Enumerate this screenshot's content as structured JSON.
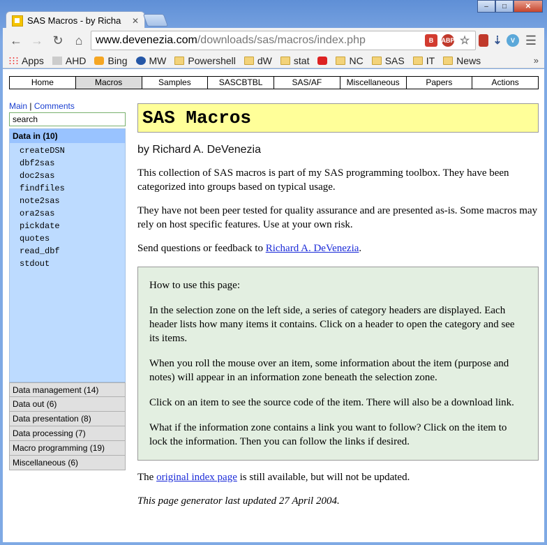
{
  "browser": {
    "tab_title": "SAS Macros - by Richa",
    "url_host": "www.devenezia.com",
    "url_path": "/downloads/sas/macros/index.php",
    "bookmarks": [
      "Apps",
      "AHD",
      "Bing",
      "MW",
      "Powershell",
      "dW",
      "stat",
      "",
      "NC",
      "SAS",
      "IT",
      "News"
    ],
    "bookmarks_more": "»",
    "abp_label": "ABP"
  },
  "topnav": [
    "Home",
    "Macros",
    "Samples",
    "SASCBTBL",
    "SAS/AF",
    "Miscellaneous",
    "Papers",
    "Actions"
  ],
  "left": {
    "link_main": "Main",
    "link_sep": "|",
    "link_comments": "Comments",
    "search_value": "search",
    "open_category": {
      "label": "Data in (10)",
      "items": [
        "createDSN",
        "dbf2sas",
        "doc2sas",
        "findfiles",
        "note2sas",
        "ora2sas",
        "pickdate",
        "quotes",
        "read_dbf",
        "stdout"
      ]
    },
    "closed_categories": [
      "Data management (14)",
      "Data out (6)",
      "Data presentation (8)",
      "Data processing (7)",
      "Macro programming (19)",
      "Miscellaneous (6)"
    ]
  },
  "main": {
    "title": "SAS Macros",
    "byline": "by Richard A. DeVenezia",
    "intro": "This collection of SAS macros is part of my SAS programming toolbox. They have been categorized into groups based on typical usage.",
    "disclaimer": "They have not been peer tested for quality assurance and are presented as-is. Some macros may rely on host specific features. Use at your own risk.",
    "feedback_prefix": "Send questions or feedback to",
    "feedback_link": "Richard A. DeVenezia",
    "feedback_suffix": ".",
    "howto": [
      "How to use this page:",
      "In the selection zone on the left side, a series of category headers are displayed. Each header lists how many items it contains. Click on a header to open the category and see its items.",
      "When you roll the mouse over an item, some information about the item (purpose and notes) will appear in an information zone beneath the selection zone.",
      "Click on an item to see the source code of the item. There will also be a download link.",
      "What if the information zone contains a link you want to follow? Click on the item to lock the information. Then you can follow the links if desired."
    ],
    "original_prefix": "The",
    "original_link": "original index page",
    "original_suffix": "is still available, but will not be updated.",
    "updated": "This page generator last updated 27 April 2004."
  }
}
